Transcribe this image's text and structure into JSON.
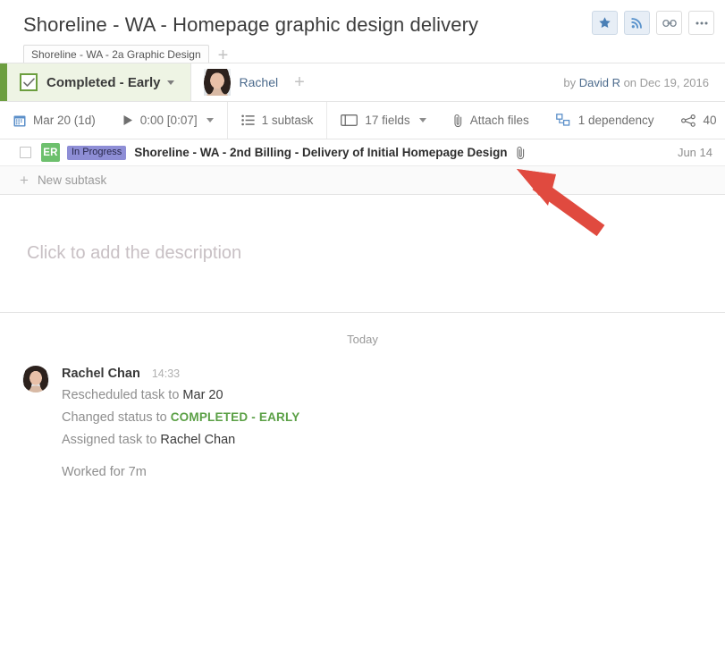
{
  "header": {
    "title": "Shoreline - WA  - Homepage graphic design delivery",
    "tag": "Shoreline - WA - 2a Graphic Design",
    "tag_add_label": "+",
    "actions": [
      {
        "name": "favorite-star",
        "glyph": "star",
        "active": true
      },
      {
        "name": "follow-feed",
        "glyph": "rss",
        "active": true
      },
      {
        "name": "copy-link",
        "glyph": "link",
        "active": false
      },
      {
        "name": "more-options",
        "glyph": "ellipsis",
        "active": false
      }
    ]
  },
  "statusbar": {
    "status_label": "Completed - Early",
    "assignee_name": "Rachel",
    "assignee_add_label": "+",
    "created_prefix": "by ",
    "created_author": "David R",
    "created_middle": " on ",
    "created_date": "Dec 19, 2016"
  },
  "toolbar": {
    "due_date": "Mar 20 (1d)",
    "timer": "0:00 [0:07]",
    "subtasks": "1 subtask",
    "fields": "17 fields",
    "attach": "Attach files",
    "dependency": "1 dependency",
    "shares": "40"
  },
  "subtasks": {
    "rows": [
      {
        "avatar_initials": "ER",
        "status_badge": "In Progress",
        "title": "Shoreline - WA - 2nd Billing - Delivery of Initial Homepage Design",
        "date": "Jun 14"
      }
    ],
    "new_label": "New subtask",
    "new_plus": "+"
  },
  "description": {
    "placeholder": "Click to add the description"
  },
  "activity": {
    "day_separator": "Today",
    "entries": [
      {
        "author": "Rachel Chan",
        "time": "14:33",
        "line1_prefix": "Rescheduled task to ",
        "line1_value": "Mar 20",
        "line2_prefix": "Changed status to ",
        "line2_value": "COMPLETED - EARLY",
        "line3_prefix": "Assigned task to ",
        "line3_value": "Rachel Chan",
        "worked": "Worked for 7m"
      }
    ]
  },
  "colors": {
    "status_green": "#6c9e3f",
    "status_bg": "#eef4e4",
    "completed_text": "#5ba046",
    "badge_purple": "#8e8ed6",
    "avatar_green": "#6dc06d",
    "link_blue": "#4b6a8c",
    "annotation_red": "#e04a3f"
  }
}
